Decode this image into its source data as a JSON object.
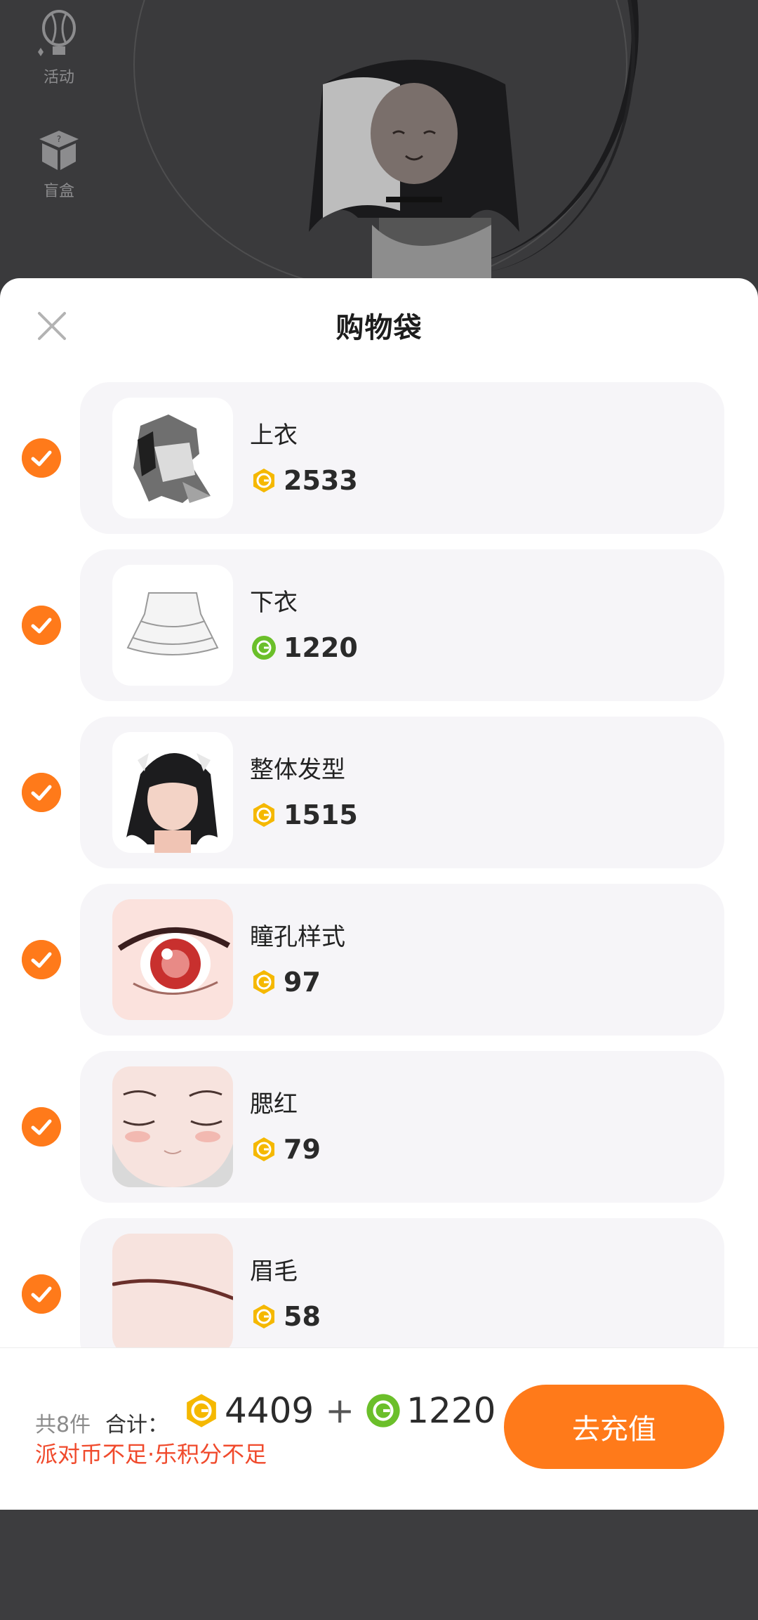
{
  "sidebar": {
    "activity_label": "活动",
    "blindbox_label": "盲盒"
  },
  "sheet": {
    "title": "购物袋"
  },
  "items": [
    {
      "name": "上衣",
      "price": "2533",
      "currency": "party-coin"
    },
    {
      "name": "下衣",
      "price": "1220",
      "currency": "fun-points"
    },
    {
      "name": "整体发型",
      "price": "1515",
      "currency": "party-coin"
    },
    {
      "name": "瞳孔样式",
      "price": "97",
      "currency": "party-coin"
    },
    {
      "name": "腮红",
      "price": "79",
      "currency": "party-coin"
    },
    {
      "name": "眉毛",
      "price": "58",
      "currency": "party-coin"
    }
  ],
  "footer": {
    "count": "共8件",
    "total_label": "合计：",
    "coin_total": "4409",
    "plus": "+",
    "points_total": "1220",
    "warning": "派对币不足·乐积分不足",
    "recharge_button": "去充值"
  },
  "colors": {
    "accent": "#ff7a1a",
    "coin_gold": "#f5b800",
    "points_green": "#6bbf2a",
    "warning": "#f04a2c"
  }
}
